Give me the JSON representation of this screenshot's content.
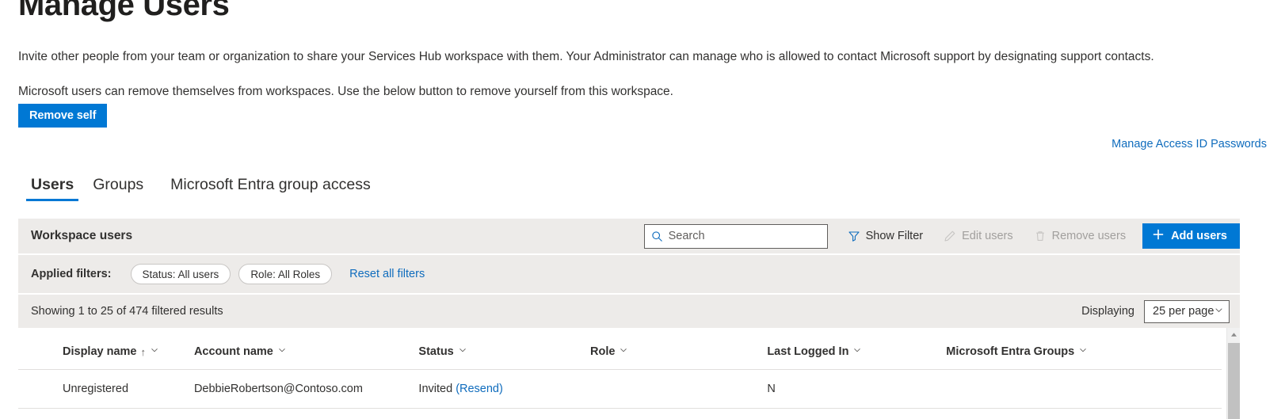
{
  "page": {
    "title": "Manage Users",
    "intro_paragraph_1": "Invite other people from your team or organization to share your Services Hub workspace with them. Your Administrator can manage who is allowed to contact Microsoft support by designating support contacts.",
    "intro_paragraph_2": "Microsoft users can remove themselves from workspaces. Use the below button to remove yourself from this workspace.",
    "remove_self_label": "Remove self",
    "manage_access_link": "Manage Access ID Passwords"
  },
  "tabs": [
    {
      "label": "Users",
      "active": true
    },
    {
      "label": "Groups",
      "active": false
    },
    {
      "label": "Microsoft Entra group access",
      "active": false
    }
  ],
  "toolbar": {
    "section_title": "Workspace users",
    "search_placeholder": "Search",
    "search_value": "",
    "show_filter_label": "Show Filter",
    "edit_users_label": "Edit users",
    "remove_users_label": "Remove users",
    "add_users_label": "Add users"
  },
  "filters": {
    "label": "Applied filters:",
    "chips": [
      "Status: All users",
      "Role: All Roles"
    ],
    "reset_label": "Reset all filters"
  },
  "results": {
    "showing_text": "Showing 1 to 25 of 474 filtered results",
    "displaying_label": "Displaying",
    "per_page_value": "25 per page"
  },
  "table": {
    "columns": [
      {
        "label": "Display name",
        "sorted": true,
        "sort_glyph": "↑"
      },
      {
        "label": "Account name",
        "sorted": false,
        "sort_glyph": ""
      },
      {
        "label": "Status",
        "sorted": false,
        "sort_glyph": ""
      },
      {
        "label": "Role",
        "sorted": false,
        "sort_glyph": ""
      },
      {
        "label": "Last Logged In",
        "sorted": false,
        "sort_glyph": ""
      },
      {
        "label": "Microsoft Entra Groups",
        "sorted": false,
        "sort_glyph": ""
      }
    ],
    "rows": [
      {
        "display_name": "Unregistered",
        "account_name": "DebbieRobertson@Contoso.com",
        "status": "Invited",
        "status_action": "(Resend)",
        "role": "",
        "last_logged_in": "N",
        "entra_groups": ""
      }
    ]
  },
  "colors": {
    "accent": "#0078d4",
    "link": "#0f6cbd",
    "band_background": "#edebe9",
    "text": "#323130",
    "disabled_text": "#a19f9d"
  },
  "icons": {
    "search": "search-icon",
    "filter": "funnel-icon",
    "edit": "pencil-icon",
    "remove": "trash-icon",
    "add": "plus-icon",
    "chevron": "chevron-down-icon"
  }
}
